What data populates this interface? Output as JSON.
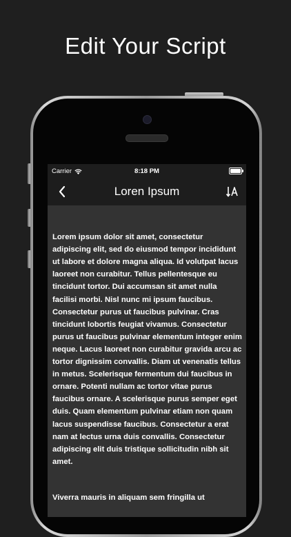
{
  "headline": "Edit Your Script",
  "status_bar": {
    "carrier": "Carrier",
    "time": "8:18 PM"
  },
  "nav": {
    "title": "Loren Ipsum",
    "back_icon": "chevron-left-icon",
    "font_icon": "text-size-icon"
  },
  "script": {
    "paragraph1": "Lorem ipsum dolor sit amet, consectetur adipiscing elit, sed do eiusmod tempor incididunt ut labore et dolore magna aliqua. Id volutpat lacus laoreet non curabitur. Tellus pellentesque eu tincidunt tortor. Dui accumsan sit amet nulla facilisi morbi. Nisl nunc mi ipsum faucibus. Consectetur purus ut faucibus pulvinar. Cras tincidunt lobortis feugiat vivamus. Consectetur purus ut faucibus pulvinar elementum integer enim neque. Lacus laoreet non curabitur gravida arcu ac tortor dignissim convallis. Diam ut venenatis tellus in metus. Scelerisque fermentum dui faucibus in ornare. Potenti nullam ac tortor vitae purus faucibus ornare. A scelerisque purus semper eget duis. Quam elementum pulvinar etiam non quam lacus suspendisse faucibus. Consectetur a erat nam at lectus urna duis convallis. Consectetur adipiscing elit duis tristique sollicitudin nibh sit amet.",
    "paragraph2": "Viverra mauris in aliquam sem fringilla ut"
  },
  "colors": {
    "background": "#1f1f1f",
    "screen": "#1d1d1d",
    "editor": "#333333",
    "text": "#ffffff"
  }
}
